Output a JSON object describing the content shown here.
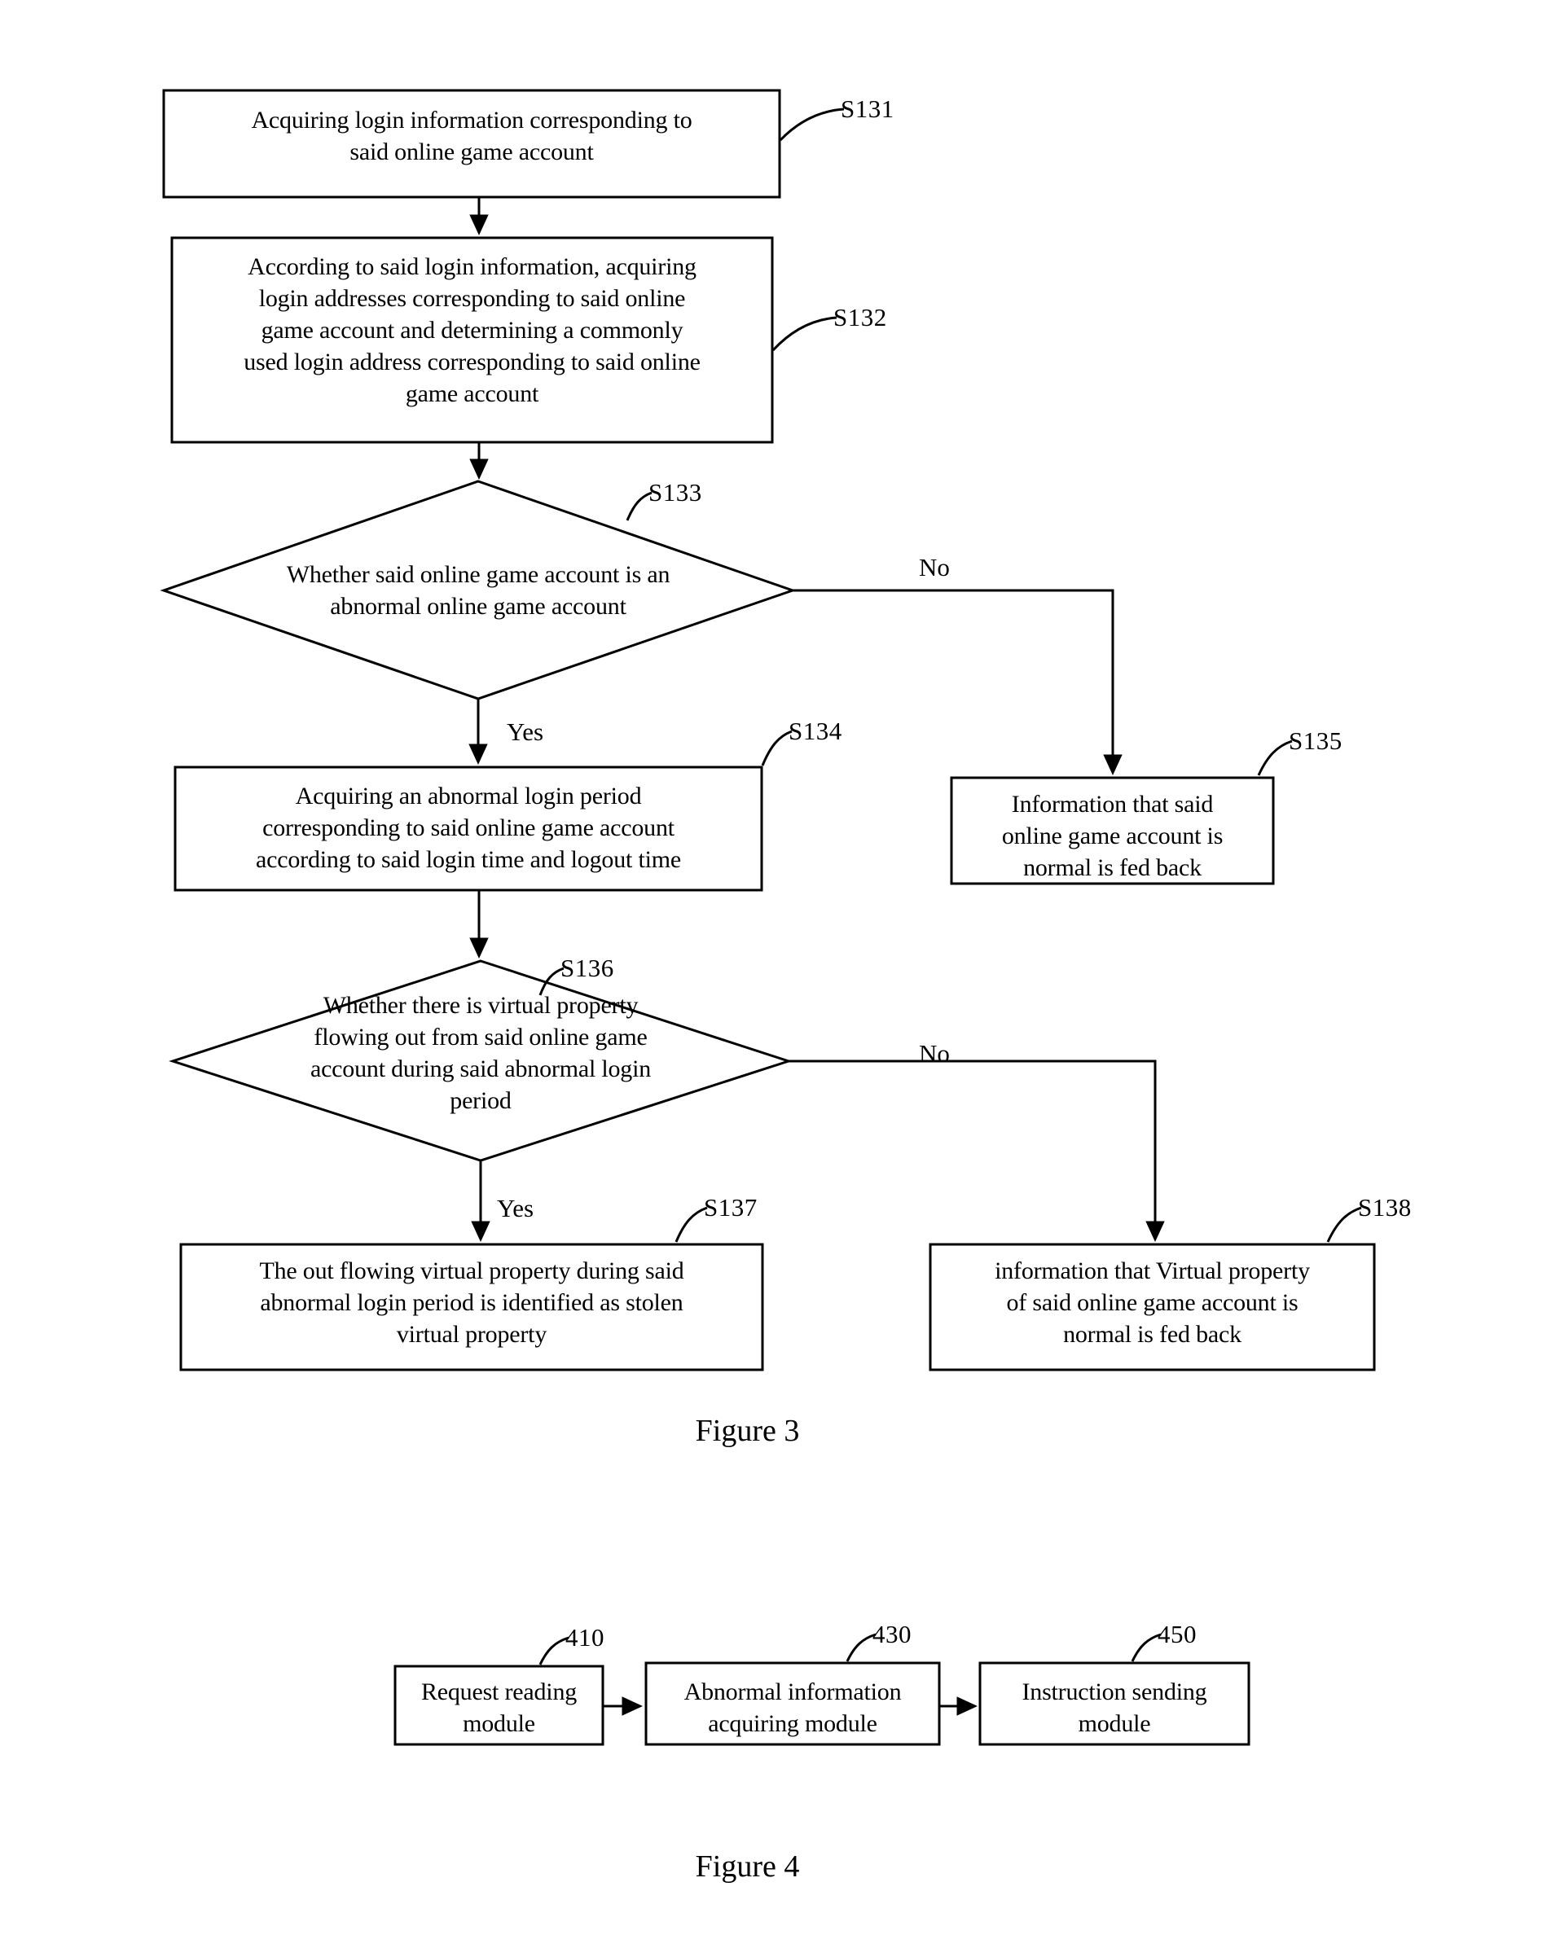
{
  "document": {
    "type": "patent-drawing-sheet"
  },
  "figure3": {
    "caption": "Figure 3",
    "nodes": [
      {
        "id": "S131",
        "ref": "S131",
        "shape": "process",
        "text": "Acquiring login information corresponding to\nsaid online game account"
      },
      {
        "id": "S132",
        "ref": "S132",
        "shape": "process",
        "text": "According to said login information, acquiring\nlogin addresses corresponding to said online\ngame account and determining a commonly\nused login address corresponding to said online\ngame account"
      },
      {
        "id": "S133",
        "ref": "S133",
        "shape": "decision",
        "text": "Whether said online game account is an\nabnormal online game account"
      },
      {
        "id": "S134",
        "ref": "S134",
        "shape": "process",
        "text": "Acquiring an abnormal login period\ncorresponding to said online game account\naccording to said login time and logout time"
      },
      {
        "id": "S135",
        "ref": "S135",
        "shape": "process",
        "text": "Information that said\nonline game account is\nnormal is fed back"
      },
      {
        "id": "S136",
        "ref": "S136",
        "shape": "decision",
        "text": "Whether there is virtual property\nflowing out from said online game\naccount during said abnormal login\nperiod"
      },
      {
        "id": "S137",
        "ref": "S137",
        "shape": "process",
        "text": "The out flowing virtual property during said\nabnormal login period is identified as stolen\nvirtual property"
      },
      {
        "id": "S138",
        "ref": "S138",
        "shape": "process",
        "text": "information that Virtual property\nof said online game account is\nnormal is fed back"
      }
    ],
    "edge_labels": {
      "s133_no": "No",
      "s133_yes": "Yes",
      "s136_no": "No",
      "s136_yes": "Yes"
    }
  },
  "figure4": {
    "caption": "Figure 4",
    "nodes": [
      {
        "id": "410",
        "ref": "410",
        "text": "Request reading\nmodule"
      },
      {
        "id": "430",
        "ref": "430",
        "text": "Abnormal information\nacquiring module"
      },
      {
        "id": "450",
        "ref": "450",
        "text": "Instruction sending\nmodule"
      }
    ]
  },
  "style": {
    "ink": "#000000",
    "paper": "#ffffff"
  }
}
